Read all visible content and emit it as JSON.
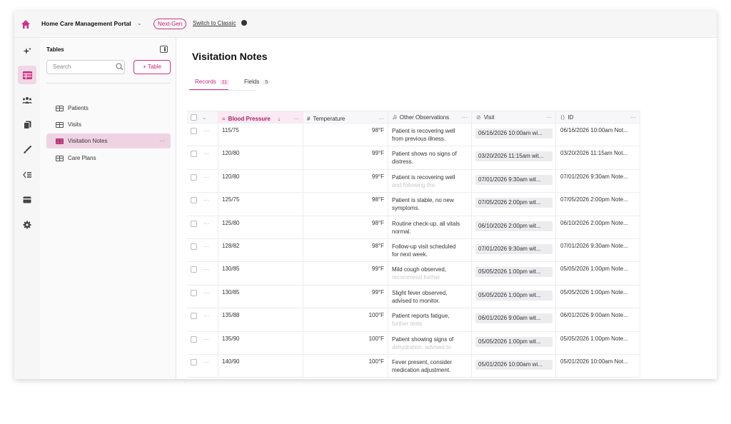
{
  "header": {
    "portal_title": "Home Care Management Portal",
    "nextgen_label": "Next-Gen",
    "classic_link": "Switch to Classic"
  },
  "rail": {
    "icons": [
      "home-icon",
      "ai-sparkle-icon",
      "table-icon",
      "users-icon",
      "documents-icon",
      "paint-brush-icon",
      "dataset-icon",
      "card-icon",
      "settings-icon"
    ],
    "accent": "#d0308a",
    "active_bg": "#f1d6e6"
  },
  "sidebar": {
    "title": "Tables",
    "search_placeholder": "Search",
    "add_table_label": "+ Table",
    "items": [
      {
        "label": "Patients"
      },
      {
        "label": "Visits"
      },
      {
        "label": "Visitation Notes",
        "active": true,
        "more": "···"
      },
      {
        "label": "Care Plans"
      }
    ]
  },
  "main": {
    "title": "Visitation Notes",
    "tabs": [
      {
        "label": "Records",
        "count": "11",
        "active": true
      },
      {
        "label": "Fields",
        "count": "5"
      }
    ],
    "columns": {
      "blood_pressure": "Blood Pressure",
      "temperature": "Temperature",
      "observations": "Other Observations",
      "visit": "Visit",
      "id": "ID"
    },
    "rows": [
      {
        "bp": "115/75",
        "temp": "98°F",
        "obs1": "Patient is recovering well",
        "obs2": "from previous illness.",
        "faded": false,
        "visit": "06/16/2026 10:00am wi...",
        "id": "06/16/2026 10:00am Not..."
      },
      {
        "bp": "120/80",
        "temp": "99°F",
        "obs1": "Patient shows no signs of",
        "obs2": "distress.",
        "faded": false,
        "visit": "03/20/2026 11:15am wit...",
        "id": "03/20/2026 11:15am Not..."
      },
      {
        "bp": "120/80",
        "temp": "99°F",
        "obs1": "Patient is recovering well",
        "obs2": "and following the",
        "faded": true,
        "visit": "07/01/2026 9:30am wit...",
        "id": "07/01/2026 9:30am Note..."
      },
      {
        "bp": "125/75",
        "temp": "98°F",
        "obs1": "Patient is stable, no new",
        "obs2": "symptoms.",
        "faded": false,
        "visit": "07/05/2026 2:00pm wit...",
        "id": "07/05/2026 2:00pm Note..."
      },
      {
        "bp": "125/80",
        "temp": "98°F",
        "obs1": "Routine check-up, all vitals",
        "obs2": "normal.",
        "faded": false,
        "visit": "06/10/2026 2:00pm wit...",
        "id": "06/10/2026 2:00pm Note..."
      },
      {
        "bp": "128/82",
        "temp": "98°F",
        "obs1": "Follow-up visit scheduled",
        "obs2": "for next week.",
        "faded": false,
        "visit": "07/01/2026 9:30am wit...",
        "id": "07/01/2026 9:30am Note..."
      },
      {
        "bp": "130/85",
        "temp": "99°F",
        "obs1": "Mild cough observed,",
        "obs2": "recommend further",
        "faded": true,
        "visit": "05/05/2026 1:00pm wit...",
        "id": "05/05/2026 1:00pm Note..."
      },
      {
        "bp": "130/85",
        "temp": "99°F",
        "obs1": "Slight fever observed,",
        "obs2": "advised to monitor.",
        "faded": false,
        "visit": "05/05/2026 1:00pm wit...",
        "id": "05/05/2026 1:00pm Note..."
      },
      {
        "bp": "135/88",
        "temp": "100°F",
        "obs1": "Patient reports fatigue,",
        "obs2": "further tests",
        "faded": true,
        "visit": "06/01/2026 9:00am wit...",
        "id": "06/01/2026 9:00am Note..."
      },
      {
        "bp": "135/90",
        "temp": "100°F",
        "obs1": "Patient showing signs of",
        "obs2": "dehydration, advised to",
        "faded": true,
        "visit": "05/05/2026 1:00pm wit...",
        "id": "05/05/2026 1:00pm Note..."
      },
      {
        "bp": "140/90",
        "temp": "100°F",
        "obs1": "Fever present, consider",
        "obs2": "medication adjustment.",
        "faded": false,
        "visit": "05/01/2026 10:00am wi...",
        "id": "05/01/2026 10:00am Not..."
      }
    ]
  }
}
